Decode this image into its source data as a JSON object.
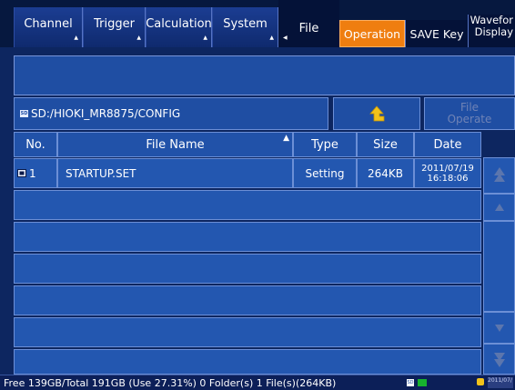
{
  "menu": {
    "tabs": [
      {
        "label": "Channel"
      },
      {
        "label": "Trigger"
      },
      {
        "label": "Calculation"
      },
      {
        "label": "System"
      },
      {
        "label": "File"
      }
    ],
    "operations": [
      {
        "label": "Operation"
      },
      {
        "label": "SAVE Key"
      },
      {
        "label": "Waveform Display"
      }
    ],
    "wave_line1": "Wavefor",
    "wave_line2": "Display"
  },
  "path": {
    "sd_icon": "SD",
    "text": "SD:/HIOKI_MR8875/CONFIG"
  },
  "file_operate": {
    "line1": "File",
    "line2": "Operate"
  },
  "table": {
    "headers": {
      "no": "No.",
      "name": "File Name",
      "type": "Type",
      "size": "Size",
      "date": "Date"
    },
    "rows": [
      {
        "no": "1",
        "name": "STARTUP.SET",
        "type": "Setting",
        "size": "264KB",
        "date": "2011/07/19",
        "time": "16:18:06"
      }
    ]
  },
  "status": {
    "text": "Free 139GB/Total 191GB (Use 27.31%)  0 Folder(s) 1 File(s)(264KB)",
    "sd_label": "SD",
    "datetime": "2011/07/"
  },
  "colors": {
    "background": "#0d2660",
    "panel": "#1f4ea3",
    "active_operation": "#ef7e10",
    "up_arrow": "#f1c21a"
  }
}
